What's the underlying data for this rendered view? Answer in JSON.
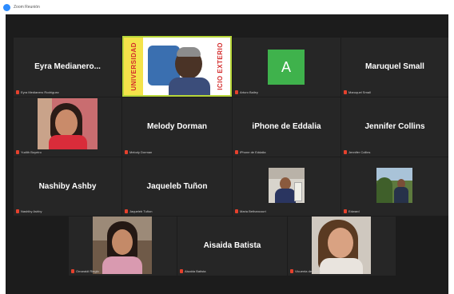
{
  "window": {
    "title": "Zoom Reunión"
  },
  "colors": {
    "stage": "#1c1c1c",
    "tile": "#262626",
    "active_speaker": "#b7d63a",
    "mute": "#e5412d",
    "avatar_a": "#3fb24c"
  },
  "participants": [
    {
      "name": "Eyra  Medianero...",
      "caption": "Eyra Medianero Rodríguez"
    },
    {
      "name": "",
      "caption": "",
      "banner_left": "UNIVERSIDAD",
      "banner_right": "ICIO EXTERIO"
    },
    {
      "name": "A",
      "caption": "Arturo Bailey"
    },
    {
      "name": "Maruquel Small",
      "caption": "Maruquel Small"
    },
    {
      "name": "",
      "caption": "Yudith Boyeiro"
    },
    {
      "name": "Melody Dorman",
      "caption": "Melody Dorman"
    },
    {
      "name": "iPhone de Eddalia",
      "caption": "iPhone de Eddalia"
    },
    {
      "name": "Jennifer Collins",
      "caption": "Jennifer Collins"
    },
    {
      "name": "Nashiby Ashby",
      "caption": "Nashiby Ashby"
    },
    {
      "name": "Jaqueleb Tuñon",
      "caption": "Jaqueleb Tuñon"
    },
    {
      "name": "",
      "caption": "Maria Bethancourt"
    },
    {
      "name": "",
      "caption": "Edward"
    },
    {
      "name": "",
      "caption": "Omaraidi Rieglo"
    },
    {
      "name": "Aisaida Batista",
      "caption": "Aisaida Batista"
    },
    {
      "name": "",
      "caption": "Vicuenta de Zoom"
    }
  ]
}
